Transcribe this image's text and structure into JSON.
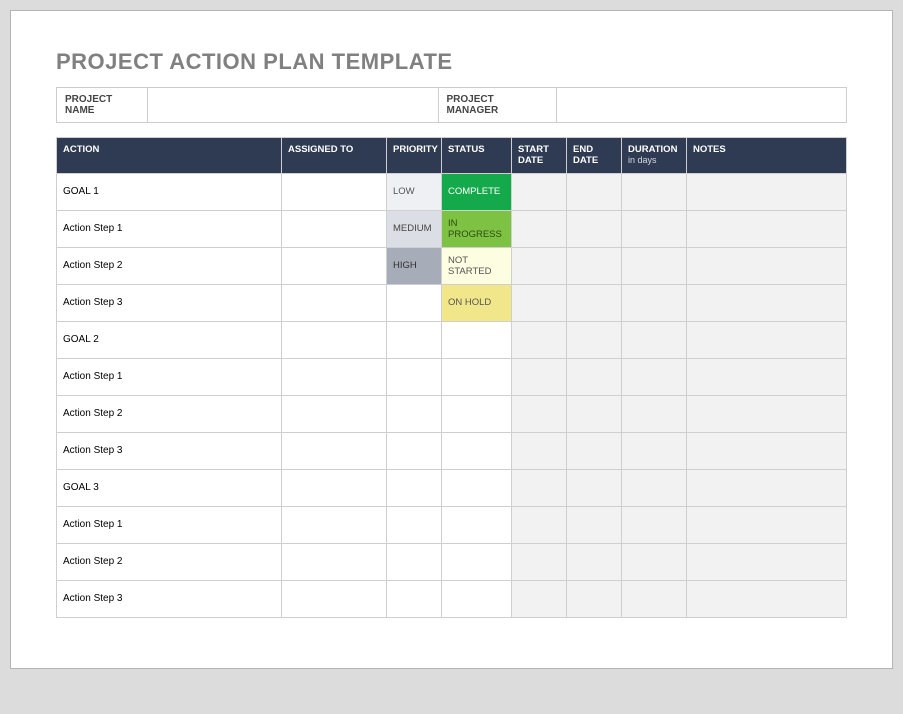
{
  "title": "PROJECT ACTION PLAN TEMPLATE",
  "meta": {
    "project_name_label": "PROJECT NAME",
    "project_name_value": "",
    "project_manager_label": "PROJECT MANAGER",
    "project_manager_value": ""
  },
  "columns": {
    "action": "ACTION",
    "assigned_to": "ASSIGNED TO",
    "priority": "PRIORITY",
    "status": "STATUS",
    "start_date": "START DATE",
    "end_date": "END DATE",
    "duration": "DURATION",
    "duration_sub": "in days",
    "notes": "NOTES"
  },
  "priority_labels": {
    "low": "LOW",
    "medium": "MEDIUM",
    "high": "HIGH"
  },
  "status_labels": {
    "complete": "COMPLETE",
    "in_progress": "IN PROGRESS",
    "not_started": "NOT STARTED",
    "on_hold": "ON HOLD"
  },
  "rows": [
    {
      "action": "GOAL 1",
      "assigned_to": "",
      "priority": "low",
      "status": "complete",
      "start": "",
      "end": "",
      "duration": "",
      "notes": ""
    },
    {
      "action": "Action Step 1",
      "assigned_to": "",
      "priority": "medium",
      "status": "in_progress",
      "start": "",
      "end": "",
      "duration": "",
      "notes": ""
    },
    {
      "action": "Action Step 2",
      "assigned_to": "",
      "priority": "high",
      "status": "not_started",
      "start": "",
      "end": "",
      "duration": "",
      "notes": ""
    },
    {
      "action": "Action Step 3",
      "assigned_to": "",
      "priority": "",
      "status": "on_hold",
      "start": "",
      "end": "",
      "duration": "",
      "notes": ""
    },
    {
      "action": "GOAL 2",
      "assigned_to": "",
      "priority": "",
      "status": "",
      "start": "",
      "end": "",
      "duration": "",
      "notes": ""
    },
    {
      "action": "Action Step 1",
      "assigned_to": "",
      "priority": "",
      "status": "",
      "start": "",
      "end": "",
      "duration": "",
      "notes": ""
    },
    {
      "action": "Action Step 2",
      "assigned_to": "",
      "priority": "",
      "status": "",
      "start": "",
      "end": "",
      "duration": "",
      "notes": ""
    },
    {
      "action": "Action Step 3",
      "assigned_to": "",
      "priority": "",
      "status": "",
      "start": "",
      "end": "",
      "duration": "",
      "notes": ""
    },
    {
      "action": "GOAL 3",
      "assigned_to": "",
      "priority": "",
      "status": "",
      "start": "",
      "end": "",
      "duration": "",
      "notes": ""
    },
    {
      "action": "Action Step 1",
      "assigned_to": "",
      "priority": "",
      "status": "",
      "start": "",
      "end": "",
      "duration": "",
      "notes": ""
    },
    {
      "action": "Action Step 2",
      "assigned_to": "",
      "priority": "",
      "status": "",
      "start": "",
      "end": "",
      "duration": "",
      "notes": ""
    },
    {
      "action": "Action Step 3",
      "assigned_to": "",
      "priority": "",
      "status": "",
      "start": "",
      "end": "",
      "duration": "",
      "notes": ""
    }
  ]
}
